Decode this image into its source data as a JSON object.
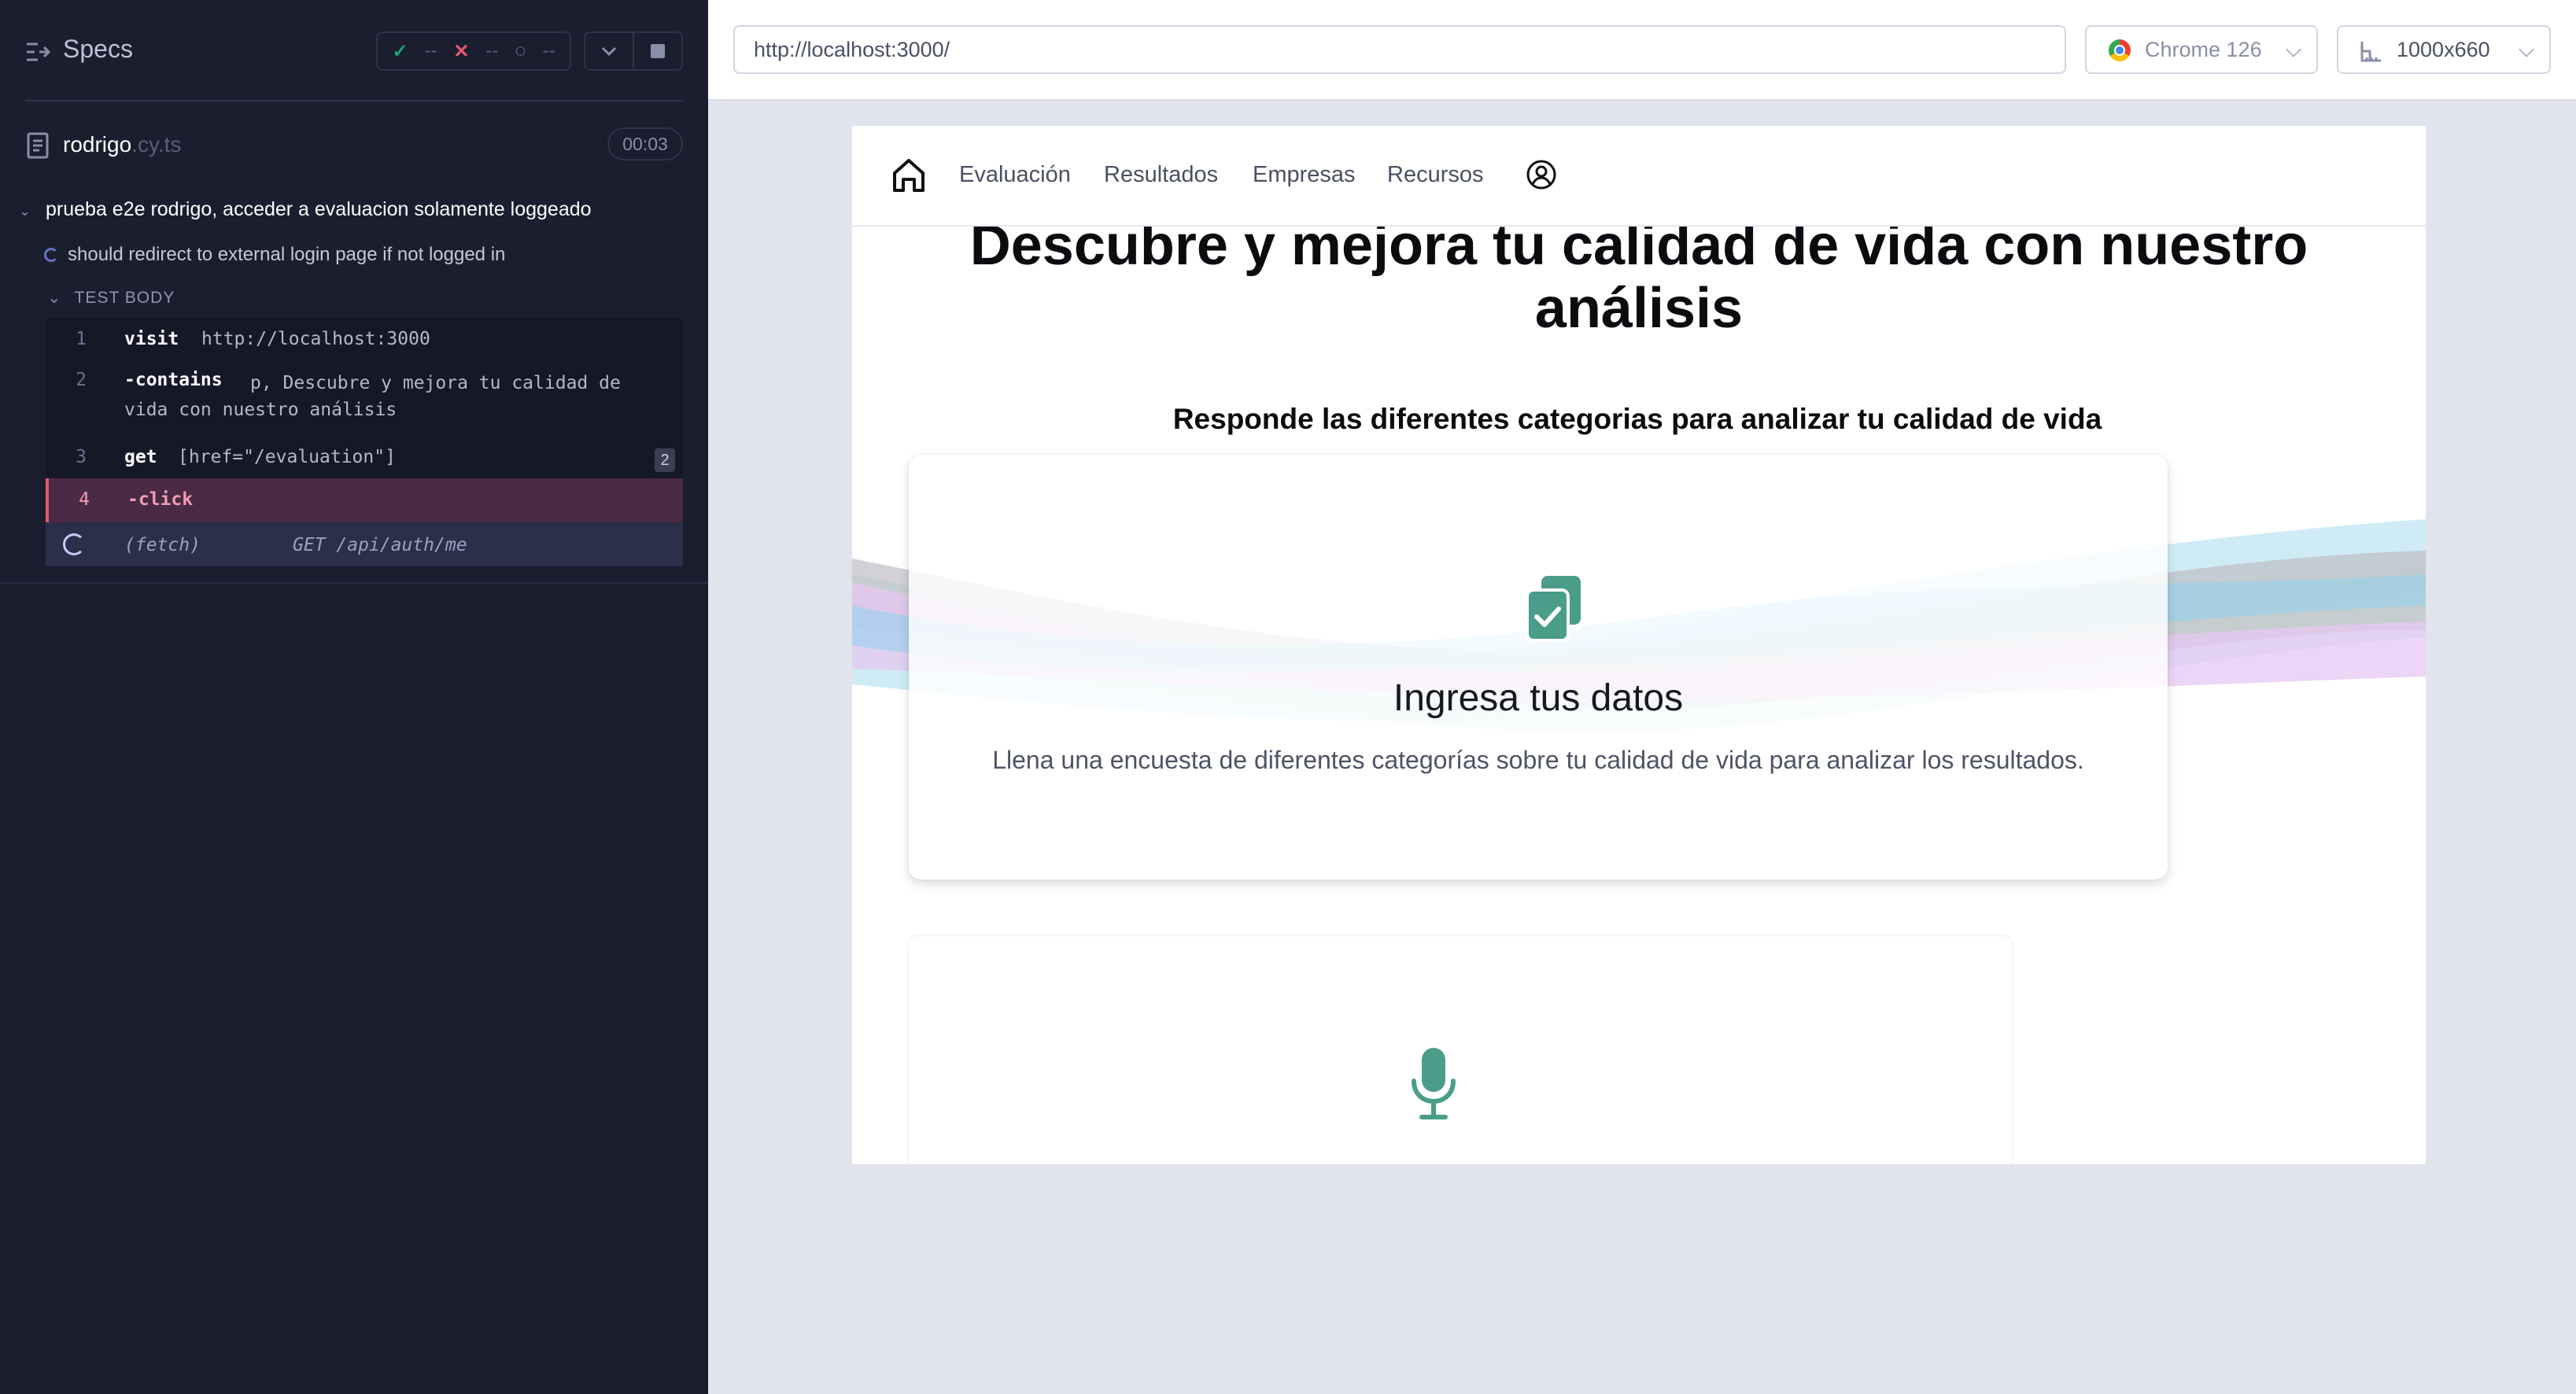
{
  "reporter": {
    "specs_label": "Specs",
    "stats": {
      "passed": "--",
      "failed": "--",
      "pending": "--"
    },
    "file": {
      "name": "rodrigo",
      "ext": ".cy.ts",
      "duration": "00:03"
    },
    "suite_title": "prueba e2e rodrigo, acceder a evaluacion solamente loggeado",
    "test_title": "should redirect to external login page if not logged in",
    "section_label": "TEST BODY",
    "commands": [
      {
        "num": "1",
        "name": "visit",
        "message": "http://localhost:3000"
      },
      {
        "num": "2",
        "name": "-contains",
        "message": "p, Descubre y mejora tu calidad de vida con nuestro análisis"
      },
      {
        "num": "3",
        "name": "get",
        "message": "[href=\"/evaluation\"]",
        "badge": "2"
      },
      {
        "num": "4",
        "name": "-click",
        "message": ""
      },
      {
        "num": "",
        "name": "(fetch)",
        "message": "GET /api/auth/me"
      }
    ]
  },
  "toolbar": {
    "url": "http://localhost:3000/",
    "browser": "Chrome 126",
    "viewport": "1000x660"
  },
  "app": {
    "nav": [
      "Evaluación",
      "Resultados",
      "Empresas",
      "Recursos"
    ],
    "hero_title": "Descubre y mejora tu calidad de vida con nuestro análisis",
    "hero_subtitle": "Responde las diferentes categorias para analizar tu calidad de vida",
    "card1": {
      "title": "Ingresa tus datos",
      "text": "Llena una encuesta de diferentes categorías sobre tu calidad de vida para analizar los resultados."
    },
    "colors": {
      "accent": "#4a9d88",
      "reporter_bg": "#1b1e2e",
      "active_cmd": "#e45770"
    }
  }
}
